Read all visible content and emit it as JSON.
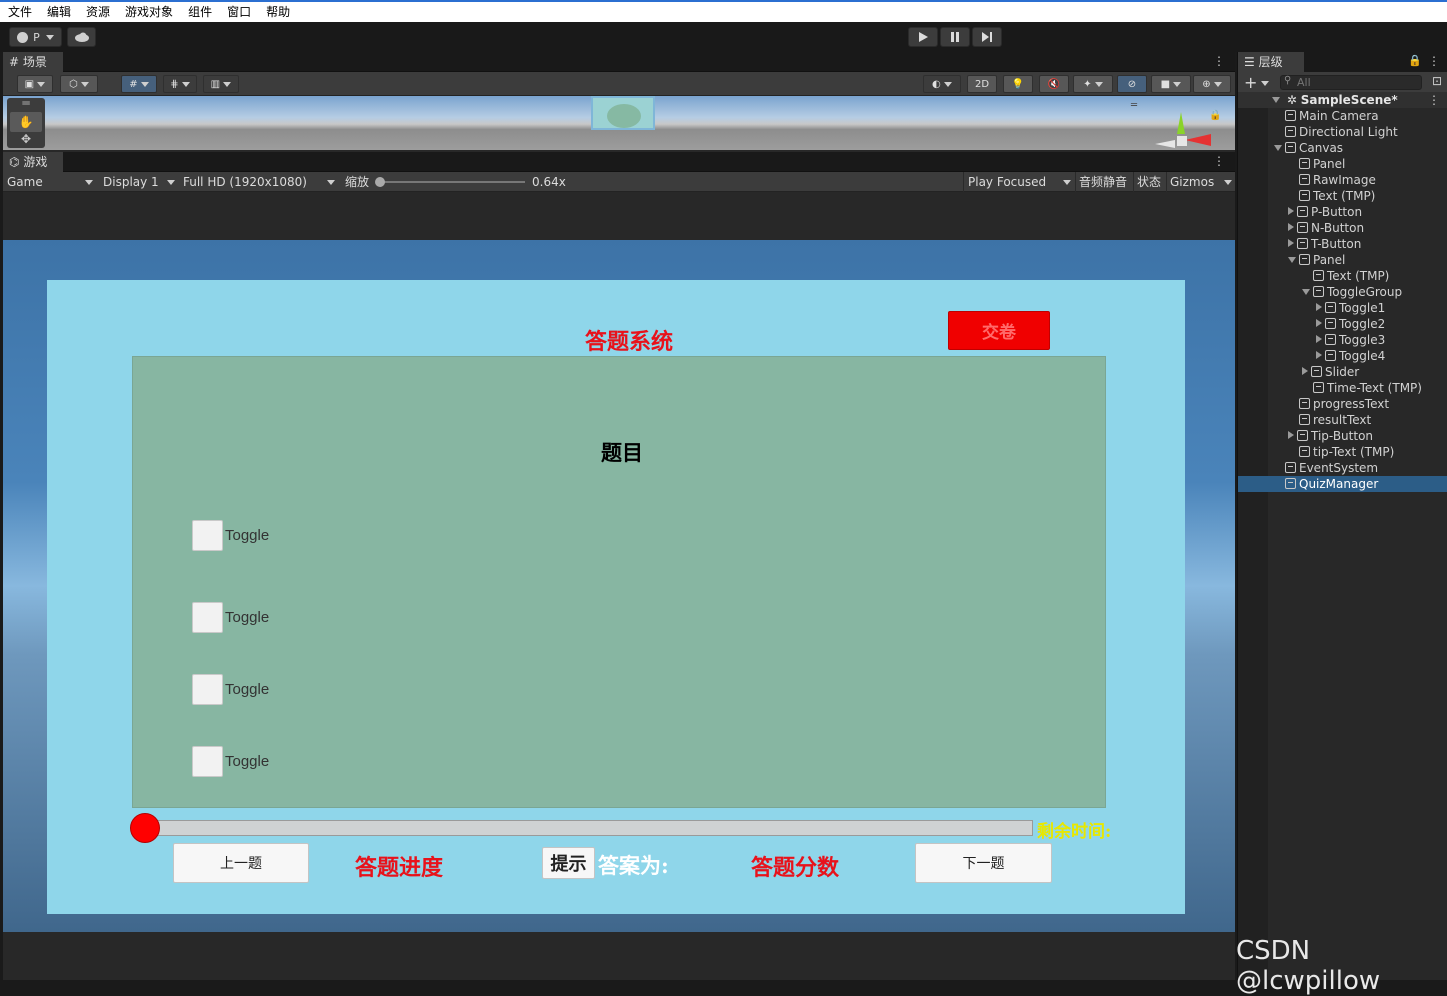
{
  "menu": [
    "文件",
    "编辑",
    "资源",
    "游戏对象",
    "组件",
    "窗口",
    "帮助"
  ],
  "toolbar": {
    "account_label": "P"
  },
  "scene_tab": {
    "label": "场景"
  },
  "game_tab": {
    "label": "游戏"
  },
  "scene_tools": {
    "mode_2d": "2D"
  },
  "game_bar": {
    "view": "Game",
    "display": "Display 1",
    "resolution": "Full HD (1920x1080)",
    "scale_label": "缩放",
    "scale_value": "0.64x",
    "scale_fraction": 0.0,
    "play_mode": "Play Focused",
    "mute": "音频静音",
    "stats": "状态",
    "gizmos": "Gizmos"
  },
  "game": {
    "title": "答题系统",
    "submit_button": "交卷",
    "question": "题目",
    "toggles": [
      "Toggle",
      "Toggle",
      "Toggle",
      "Toggle"
    ],
    "time_label": "剩余时间:",
    "prev_button": "上一题",
    "progress_label": "答题进度",
    "tip_button": "提示",
    "answer_label": "答案为:",
    "score_label": "答题分数",
    "next_button": "下一题",
    "slider_fraction": 0.0
  },
  "hierarchy": {
    "tab_label": "层级",
    "search_placeholder": "All",
    "scene": "SampleScene*",
    "items": [
      {
        "label": "Main Camera",
        "depth": 1,
        "expand": "none"
      },
      {
        "label": "Directional Light",
        "depth": 1,
        "expand": "none"
      },
      {
        "label": "Canvas",
        "depth": 1,
        "expand": "open"
      },
      {
        "label": "Panel",
        "depth": 2,
        "expand": "none"
      },
      {
        "label": "RawImage",
        "depth": 2,
        "expand": "none"
      },
      {
        "label": "Text (TMP)",
        "depth": 2,
        "expand": "none"
      },
      {
        "label": "P-Button",
        "depth": 2,
        "expand": "closed"
      },
      {
        "label": "N-Button",
        "depth": 2,
        "expand": "closed"
      },
      {
        "label": "T-Button",
        "depth": 2,
        "expand": "closed"
      },
      {
        "label": "Panel",
        "depth": 2,
        "expand": "open"
      },
      {
        "label": "Text (TMP)",
        "depth": 3,
        "expand": "none"
      },
      {
        "label": "ToggleGroup",
        "depth": 3,
        "expand": "open"
      },
      {
        "label": "Toggle1",
        "depth": 4,
        "expand": "closed"
      },
      {
        "label": "Toggle2",
        "depth": 4,
        "expand": "closed"
      },
      {
        "label": "Toggle3",
        "depth": 4,
        "expand": "closed"
      },
      {
        "label": "Toggle4",
        "depth": 4,
        "expand": "closed"
      },
      {
        "label": "Slider",
        "depth": 3,
        "expand": "closed"
      },
      {
        "label": "Time-Text (TMP)",
        "depth": 3,
        "expand": "none"
      },
      {
        "label": "progressText",
        "depth": 2,
        "expand": "none"
      },
      {
        "label": "resultText",
        "depth": 2,
        "expand": "none"
      },
      {
        "label": "Tip-Button",
        "depth": 2,
        "expand": "closed"
      },
      {
        "label": "tip-Text (TMP)",
        "depth": 2,
        "expand": "none"
      },
      {
        "label": "EventSystem",
        "depth": 1,
        "expand": "none"
      },
      {
        "label": "QuizManager",
        "depth": 1,
        "expand": "none",
        "selected": true
      }
    ]
  },
  "watermark": "CSDN @lcwpillow",
  "colors": {
    "title_red": "#e8121b",
    "submit_red": "#f00000",
    "time_yellow": "#e8e800",
    "panel_cyan": "#8fd6ea",
    "inner_green": "#87b6a2",
    "slider_handle": "#ff0000",
    "selection": "#2c5d87"
  }
}
